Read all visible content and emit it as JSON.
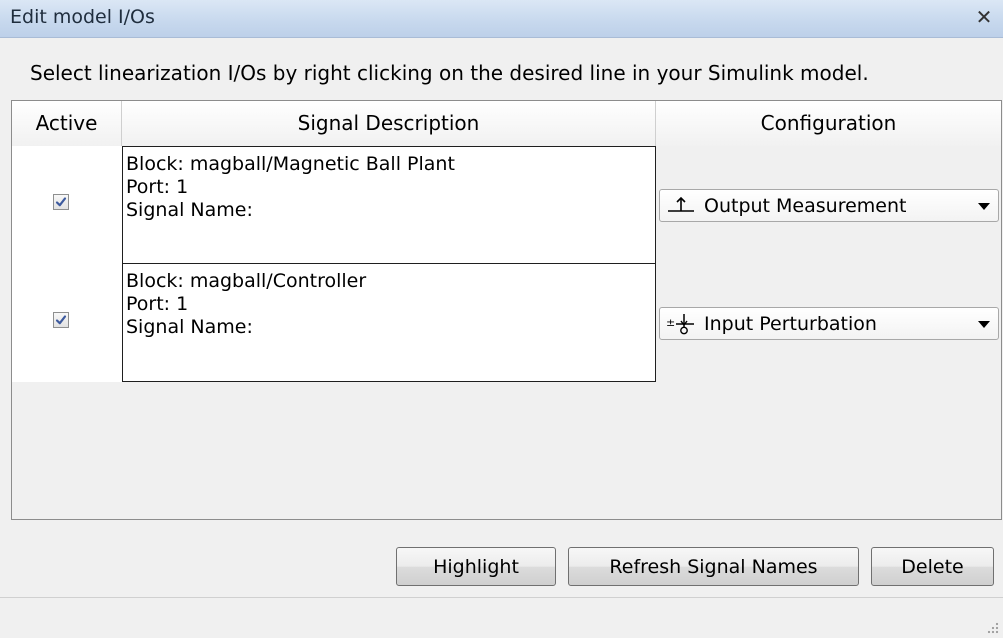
{
  "window": {
    "title": "Edit model I/Os",
    "close_glyph": "✕"
  },
  "instruction": "Select linearization I/Os by right clicking on the desired line in your Simulink model.",
  "table": {
    "columns": [
      "Active",
      "Signal Description",
      "Configuration"
    ],
    "rows": [
      {
        "active": true,
        "block": "Block: magball/Magnetic Ball Plant",
        "port": "Port: 1",
        "signal_name": "Signal Name:",
        "configuration": "Output Measurement",
        "config_icon": "output-measurement-icon"
      },
      {
        "active": true,
        "block": "Block: magball/Controller",
        "port": "Port: 1",
        "signal_name": "Signal Name:",
        "configuration": "Input Perturbation",
        "config_icon": "input-perturbation-icon"
      }
    ]
  },
  "buttons": {
    "highlight": "Highlight",
    "refresh": "Refresh Signal Names",
    "delete": "Delete"
  },
  "colors": {
    "titlebar": "#c8d9ee",
    "window_bg": "#f0f0f0",
    "checkmark": "#3d5a9e"
  }
}
